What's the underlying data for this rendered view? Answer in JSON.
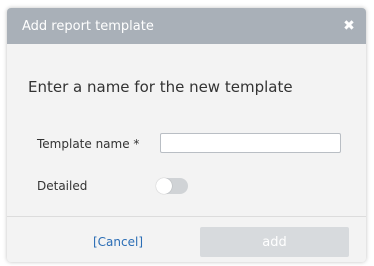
{
  "dialog": {
    "title": "Add report template",
    "close_icon": "close-icon",
    "prompt": "Enter a name for the new template",
    "fields": {
      "template_name_label": "Template name *",
      "template_name_value": "",
      "detailed_label": "Detailed",
      "detailed_on": false
    },
    "actions": {
      "cancel_label": "[Cancel]",
      "add_label": "add",
      "add_enabled": false
    }
  },
  "colors": {
    "titlebar": "#a9b0b8",
    "dialog_bg": "#f3f3f3",
    "link": "#2a6db5",
    "disabled_button": "#d7dadd"
  }
}
